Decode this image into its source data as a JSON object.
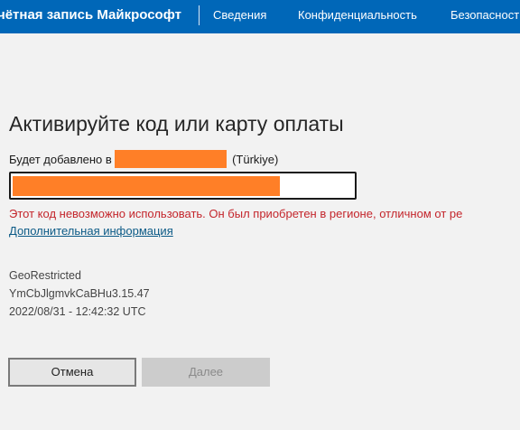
{
  "header": {
    "brand": "чётная запись Майкрософт",
    "nav": [
      "Сведения",
      "Конфиденциальность",
      "Безопасност"
    ]
  },
  "main": {
    "title": "Активируйте код или карту оплаты",
    "country_prefix": "Будет добавлено в",
    "country_suffix": "(Türkiye)",
    "code_input_value": "",
    "error_message": "Этот код невозможно использовать. Он был приобретен в регионе, отличном от ре",
    "more_info_link": "Дополнительная информация",
    "diagnostics": [
      "GeoRestricted",
      "YmCbJlgmvkCaBHu3.15.47",
      "2022/08/31 - 12:42:32 UTC"
    ]
  },
  "buttons": {
    "cancel": "Отмена",
    "next": "Далее"
  },
  "colors": {
    "nav_bg": "#0067b8",
    "error": "#c4262c",
    "link": "#0b5a86",
    "redaction": "#ff7f27"
  }
}
